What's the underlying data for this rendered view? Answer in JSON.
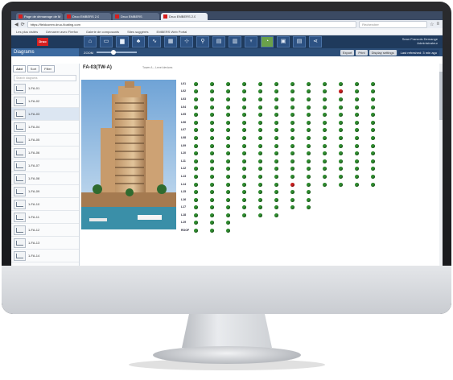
{
  "browser": {
    "tabs": [
      "Page de démarrage de Mozilla",
      "Druo EMBERS 2.0",
      "Druo EMBERS",
      "Druo EMBERS 2.0"
    ],
    "url": "https://fieldcomm.druo-floating.com",
    "search_placeholder": "Rechercher",
    "bookmarks": [
      "Les plus visités",
      "Démarrer avec Firefox",
      "Galerie de composants",
      "Sites suggérés",
      "EMBERS Web Portal"
    ]
  },
  "app": {
    "logo": "Druo",
    "user_name": "Sean Francois Demange",
    "user_role": "Administrateur",
    "nav_icons": [
      "home-icon",
      "monitor-icon",
      "chart-icon",
      "bell-icon",
      "pulse-icon",
      "grid-icon",
      "network-icon",
      "pin-icon",
      "doc-icon",
      "panel-icon",
      "plant-icon",
      "gauge-icon",
      "device-icon",
      "server-icon",
      "share-icon"
    ]
  },
  "toolbar": {
    "section_title": "Diagrams",
    "zoom_label": "ZOOM",
    "buttons": [
      "Export",
      "Print",
      "Display settings",
      "Last refreshed: 3 min ago"
    ]
  },
  "sidebar": {
    "tabs": [
      "Add",
      "Sort",
      "Filter"
    ],
    "search_placeholder": "Search diagrams",
    "items": [
      "1-FA-01",
      "1-FA-02",
      "1-FA-03",
      "1-FA-04",
      "1-FA-05",
      "1-FA-06",
      "1-FA-07",
      "1-FA-08",
      "1-FA-09",
      "1-FA-10",
      "1-FA-11",
      "1-FA-12",
      "1-FA-13",
      "1-FA-14"
    ]
  },
  "content": {
    "title": "FA-03(TW-A)",
    "subtitle": "Tower A – Level devices"
  },
  "grid": {
    "row_labels": [
      "L01",
      "L02",
      "L03",
      "L04",
      "L05",
      "L06",
      "L07",
      "L08",
      "L09",
      "L10",
      "L11",
      "L12",
      "L13",
      "L14",
      "L15",
      "L16",
      "L17",
      "L18",
      "L19",
      "ROOF"
    ],
    "columns": [
      12,
      12,
      12,
      12,
      12,
      12,
      12,
      12,
      12,
      12,
      12,
      12,
      12,
      12,
      8,
      8,
      8,
      6,
      3,
      3
    ],
    "red_cells": [
      "L02-9",
      "L14-6"
    ],
    "colors": {
      "ok": "#2e8a2e",
      "alarm": "#c81e1e"
    }
  }
}
